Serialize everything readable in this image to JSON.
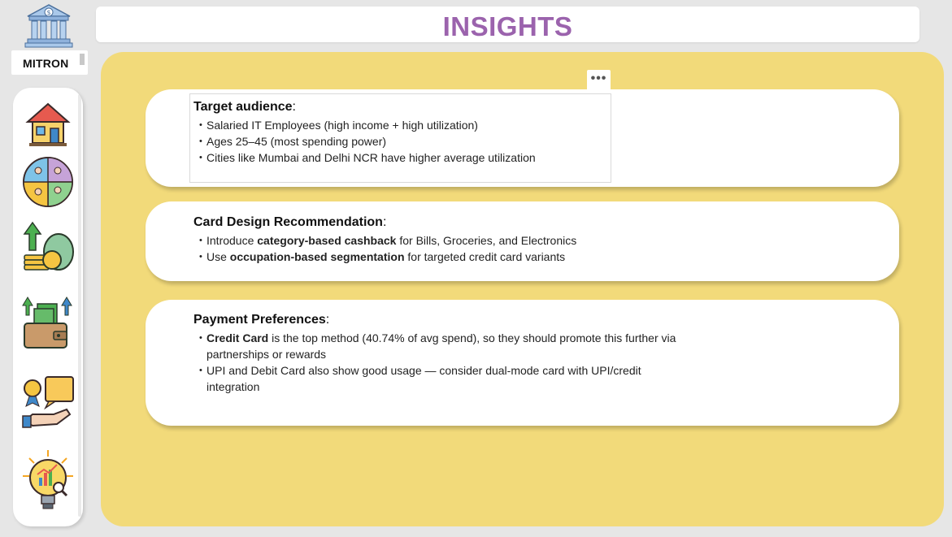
{
  "brand": {
    "name": "MITRON"
  },
  "page": {
    "title": "INSIGHTS"
  },
  "sidebar": {
    "items": [
      {
        "icon": "home-icon"
      },
      {
        "icon": "demographics-icon"
      },
      {
        "icon": "money-growth-icon"
      },
      {
        "icon": "wallet-payments-icon"
      },
      {
        "icon": "award-chat-icon"
      },
      {
        "icon": "lightbulb-insights-icon"
      }
    ]
  },
  "toolbar": {
    "more_label": "•••"
  },
  "insights": {
    "target": {
      "title": "Target audience",
      "colon": ":",
      "bullets": [
        "Salaried IT Employees (high income + high utilization)",
        "Ages 25–45 (most spending power)",
        "Cities like Mumbai and Delhi NCR have higher average utilization"
      ]
    },
    "card_design": {
      "title": "Card Design Recommendation",
      "colon": ":",
      "b1_pre": "Introduce ",
      "b1_bold": "category-based cashback",
      "b1_post": " for Bills, Groceries, and Electronics",
      "b2_pre": "Use ",
      "b2_bold": "occupation-based segmentation",
      "b2_post": " for targeted credit card variants"
    },
    "payment": {
      "title": "Payment Preferences",
      "colon": ":",
      "b1_bold": "Credit Card",
      "b1_post": " is the top method (40.74% of avg spend), so they should promote this further via partnerships or rewards",
      "b2": "UPI and Debit Card also show good usage — consider dual-mode card with UPI/credit integration"
    }
  },
  "colors": {
    "title": "#9b63ad",
    "panel": "#f2da7a",
    "background": "#e6e6e6"
  }
}
